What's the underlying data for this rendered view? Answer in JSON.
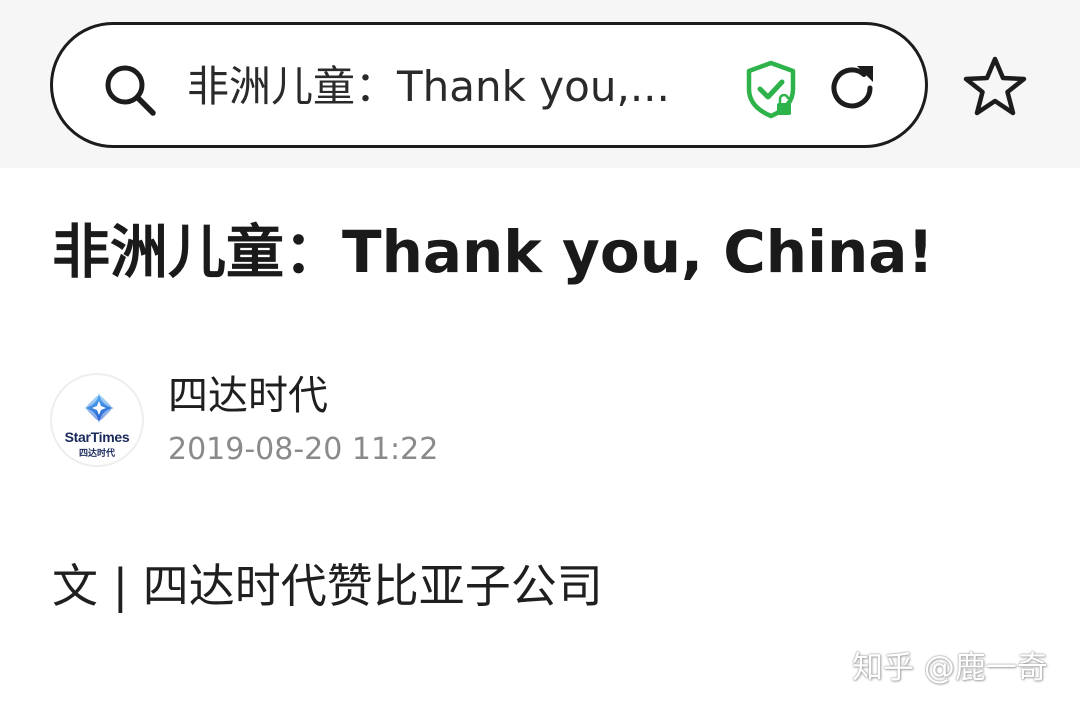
{
  "browser": {
    "url_text": "非洲儿童：Thank you,...",
    "icons": {
      "search": "search-icon",
      "security": "shield-check-lock-icon",
      "reload": "reload-icon",
      "bookmark": "star-icon"
    },
    "colors": {
      "security_green": "#2db34a"
    }
  },
  "article": {
    "title": "非洲儿童：Thank you, China!",
    "author": {
      "name": "四达时代",
      "avatar_brand": "StarTimes",
      "avatar_brand_sub": "四达时代",
      "date": "2019-08-20 11:22"
    },
    "byline": "文 | 四达时代赞比亚子公司"
  },
  "watermark": "知乎 @鹿一奇"
}
